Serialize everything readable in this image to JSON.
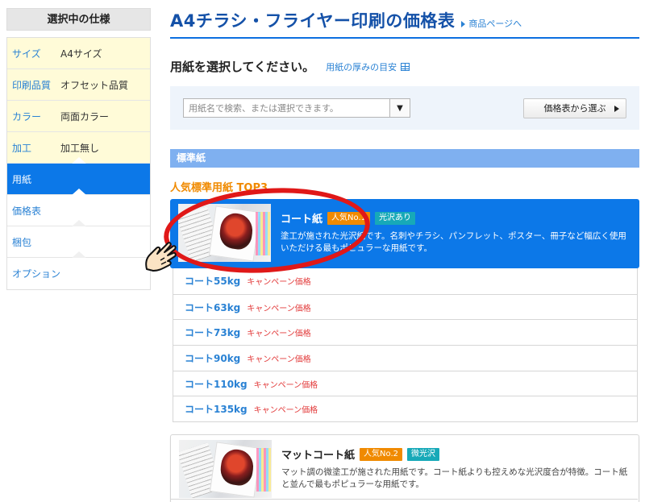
{
  "sidebar": {
    "title": "選択中の仕様",
    "items": [
      {
        "key": "サイズ",
        "value": "A4サイズ",
        "state": "done"
      },
      {
        "key": "印刷品質",
        "value": "オフセット品質",
        "state": "done"
      },
      {
        "key": "カラー",
        "value": "両面カラー",
        "state": "done"
      },
      {
        "key": "加工",
        "value": "加工無し",
        "state": "done"
      },
      {
        "key": "用紙",
        "value": "",
        "state": "active"
      },
      {
        "key": "価格表",
        "value": "",
        "state": "pending"
      },
      {
        "key": "梱包",
        "value": "",
        "state": "pending"
      },
      {
        "key": "オプション",
        "value": "",
        "state": "pending"
      }
    ]
  },
  "header": {
    "title": "A4チラシ・フライヤー印刷の価格表",
    "product_link": "商品ページへ"
  },
  "paper_select": {
    "title": "用紙を選択してください。",
    "thickness_link": "用紙の厚みの目安",
    "search_placeholder": "用紙名で検索、または選択できます。",
    "dropdown_glyph": "▼",
    "price_table_button": "価格表から選ぶ"
  },
  "section": {
    "title": "標準紙",
    "top3_title": "人気標準用紙 TOP3"
  },
  "cards": [
    {
      "name": "コート紙",
      "rank_badge": "人気No.1",
      "finish_badge": "光沢あり",
      "description": "塗工が施された光沢紙です。名刺やチラシ、パンフレット、ポスター、冊子など幅広く使用いただける最もポピュラーな用紙です。"
    },
    {
      "name": "マットコート紙",
      "rank_badge": "人気No.2",
      "finish_badge": "微光沢",
      "description": "マット調の微塗工が施された用紙です。コート紙よりも控えめな光沢度合が特徴。コート紙と並んで最もポピュラーな用紙です。"
    }
  ],
  "coat_weights": [
    {
      "name": "コート55kg",
      "campaign": "キャンペーン価格"
    },
    {
      "name": "コート63kg",
      "campaign": "キャンペーン価格"
    },
    {
      "name": "コート73kg",
      "campaign": "キャンペーン価格"
    },
    {
      "name": "コート90kg",
      "campaign": "キャンペーン価格"
    },
    {
      "name": "コート110kg",
      "campaign": "キャンペーン価格"
    },
    {
      "name": "コート135kg",
      "campaign": "キャンペーン価格"
    }
  ],
  "colors": {
    "accent_blue": "#0c78e8",
    "title_blue": "#1451a8",
    "link_blue": "#2a82d4",
    "orange": "#f08a00",
    "teal": "#17a9b8",
    "campaign_red": "#e23a3a",
    "annotation_red": "#e01818"
  }
}
